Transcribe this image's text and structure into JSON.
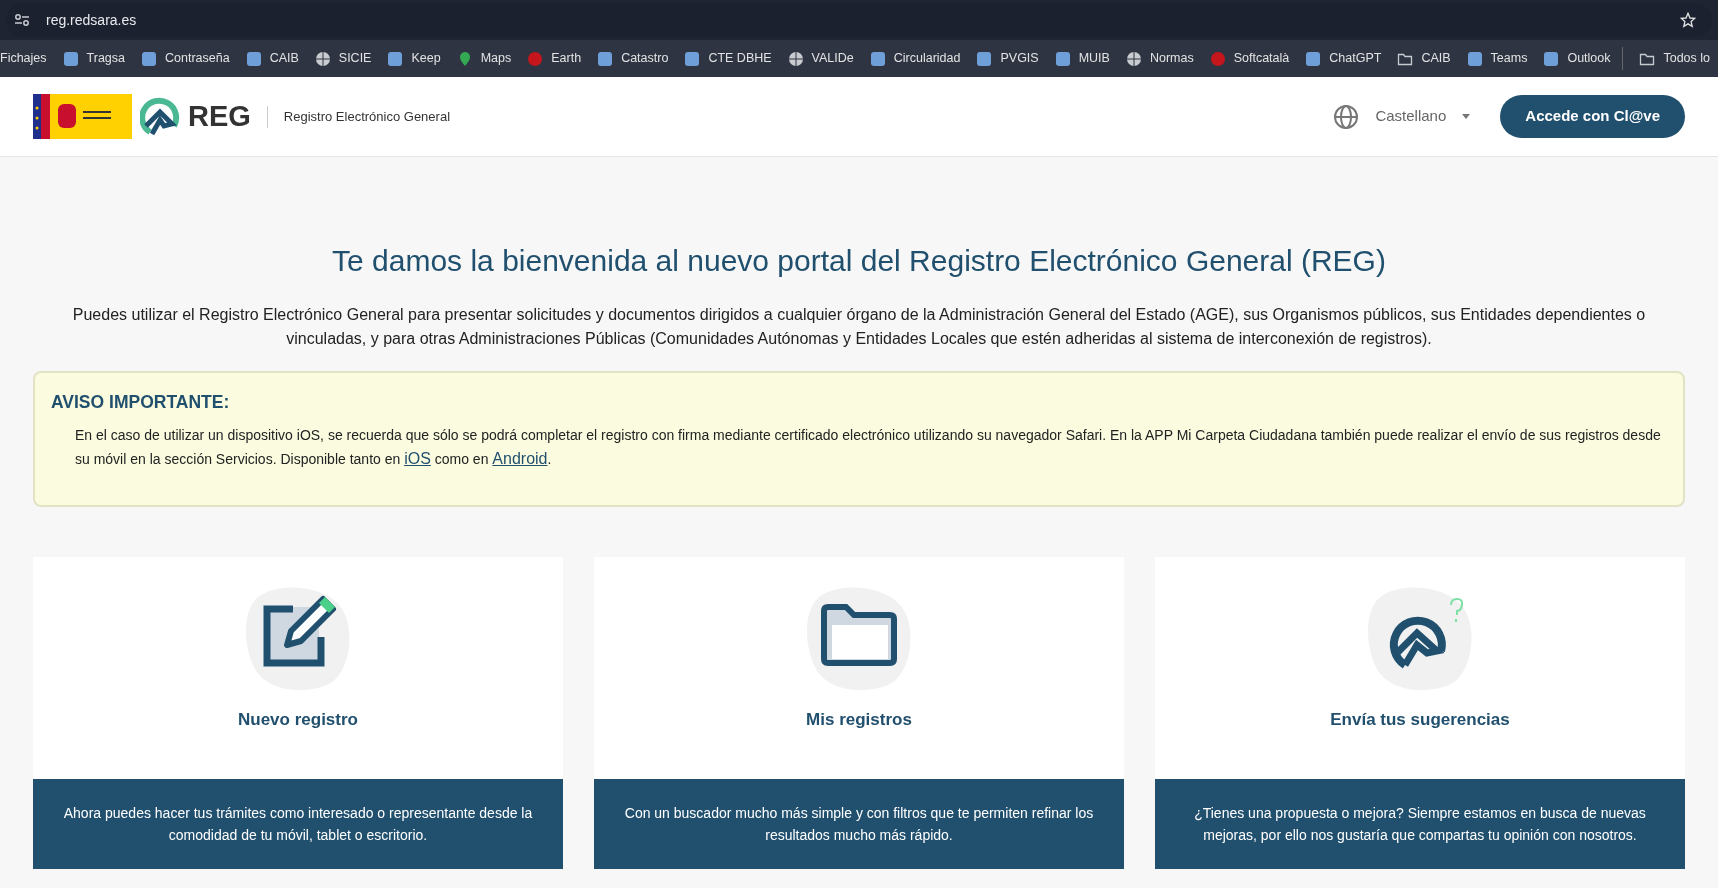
{
  "browser": {
    "url": "reg.redsara.es",
    "bookmarks": [
      {
        "label": "Fichajes",
        "kind": "none"
      },
      {
        "label": "Tragsa",
        "kind": "site"
      },
      {
        "label": "Contraseña",
        "kind": "site"
      },
      {
        "label": "CAIB",
        "kind": "site"
      },
      {
        "label": "SICIE",
        "kind": "globe"
      },
      {
        "label": "Keep",
        "kind": "site"
      },
      {
        "label": "Maps",
        "kind": "pin"
      },
      {
        "label": "Earth",
        "kind": "circle"
      },
      {
        "label": "Catastro",
        "kind": "site"
      },
      {
        "label": "CTE DBHE",
        "kind": "site"
      },
      {
        "label": "VALIDe",
        "kind": "globe"
      },
      {
        "label": "Circularidad",
        "kind": "site"
      },
      {
        "label": "PVGIS",
        "kind": "site"
      },
      {
        "label": "MUIB",
        "kind": "site"
      },
      {
        "label": "Normas",
        "kind": "globe"
      },
      {
        "label": "Softcatalà",
        "kind": "circle"
      },
      {
        "label": "ChatGPT",
        "kind": "site"
      },
      {
        "label": "CAIB",
        "kind": "folder"
      },
      {
        "label": "Teams",
        "kind": "site"
      },
      {
        "label": "Outlook",
        "kind": "site"
      }
    ],
    "other_bookmarks": "Todos lo"
  },
  "header": {
    "brand": "REG",
    "subtitle": "Registro Electrónico General",
    "language": "Castellano",
    "login_button": "Accede con Cl@ve"
  },
  "welcome": {
    "title": "Te damos la bienvenida al nuevo portal del Registro Electrónico General (REG)",
    "intro": "Puedes utilizar el Registro Electrónico General para presentar solicitudes y documentos dirigidos a cualquier órgano de la Administración General del Estado (AGE), sus Organismos públicos, sus Entidades dependientes o vinculadas, y para otras Administraciones Públicas (Comunidades Autónomas y Entidades Locales que estén adheridas al sistema de interconexión de registros)."
  },
  "notice": {
    "title": "AVISO IMPORTANTE:",
    "parts": [
      {
        "kind": "text",
        "text": "En el caso de utilizar un dispositivo iOS, se recuerda que sólo se podrá completar el registro con firma mediante certificado electrónico utilizando su navegador Safari. En la APP Mi Carpeta Ciudadana también puede realizar el envío de sus registros desde su móvil en la sección Servicios. Disponible tanto en "
      },
      {
        "kind": "link",
        "text": "iOS"
      },
      {
        "kind": "text",
        "text": " como en "
      },
      {
        "kind": "link",
        "text": "Android"
      },
      {
        "kind": "text",
        "text": "."
      }
    ]
  },
  "cards": [
    {
      "kind": "edit",
      "title": "Nuevo registro",
      "description": "Ahora puedes hacer tus trámites como interesado o representante desde la comodidad de tu móvil, tablet o escritorio."
    },
    {
      "kind": "folder",
      "title": "Mis registros",
      "description": "Con un buscador mucho más simple y con filtros que te permiten refinar los resultados mucho más rápido."
    },
    {
      "kind": "suggest",
      "title": "Envía tus sugerencias",
      "description": "¿Tienes una propuesta o mejora? Siempre estamos en busca de nuevas mejoras, por ello nos gustaría que compartas tu opinión con nosotros."
    }
  ]
}
